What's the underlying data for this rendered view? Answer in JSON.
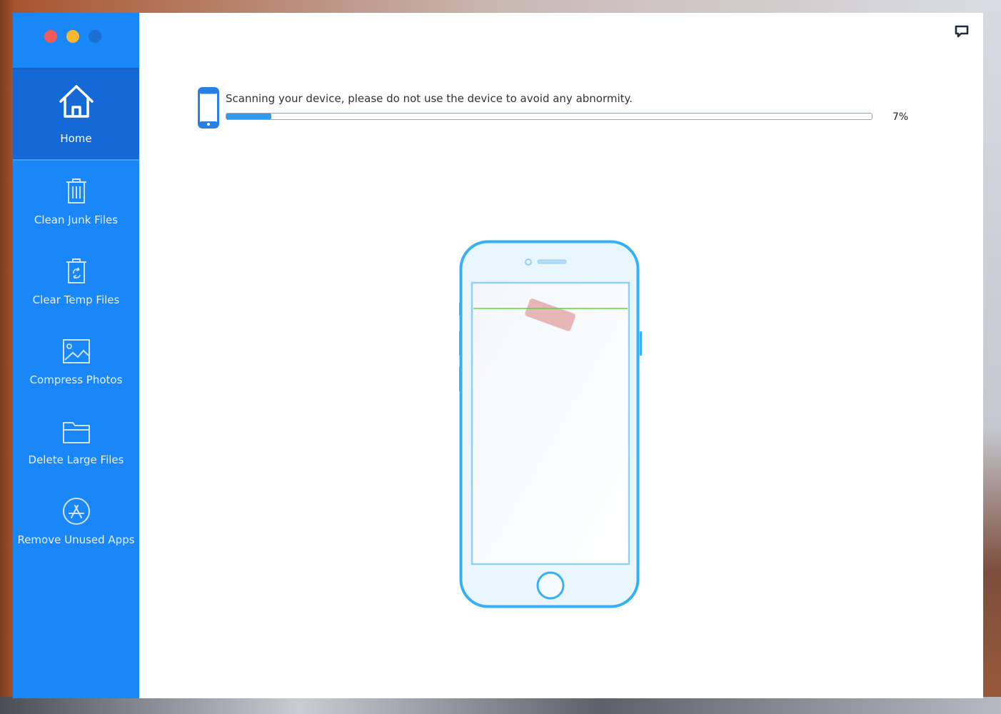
{
  "window": {
    "traffic_lights": [
      "#f25a5a",
      "#f6b830",
      "#1b6fd0"
    ]
  },
  "sidebar": {
    "color": "#1a87f8",
    "active_color": "#1469d6",
    "items": [
      {
        "label": "Home",
        "icon": "home-icon",
        "active": true
      },
      {
        "label": "Clean Junk Files",
        "icon": "trash-icon",
        "active": false
      },
      {
        "label": "Clear Temp Files",
        "icon": "recycle-bin-icon",
        "active": false
      },
      {
        "label": "Compress Photos",
        "icon": "photo-icon",
        "active": false
      },
      {
        "label": "Delete Large Files",
        "icon": "folder-icon",
        "active": false
      },
      {
        "label": "Remove Unused Apps",
        "icon": "app-store-icon",
        "active": false
      }
    ]
  },
  "scan": {
    "message": "Scanning your device, please do not use the device to avoid any abnormity.",
    "progress_label": "7%",
    "progress": 0.07,
    "accent": "#2f9bef"
  },
  "header": {
    "chat_icon": "chat-icon"
  }
}
